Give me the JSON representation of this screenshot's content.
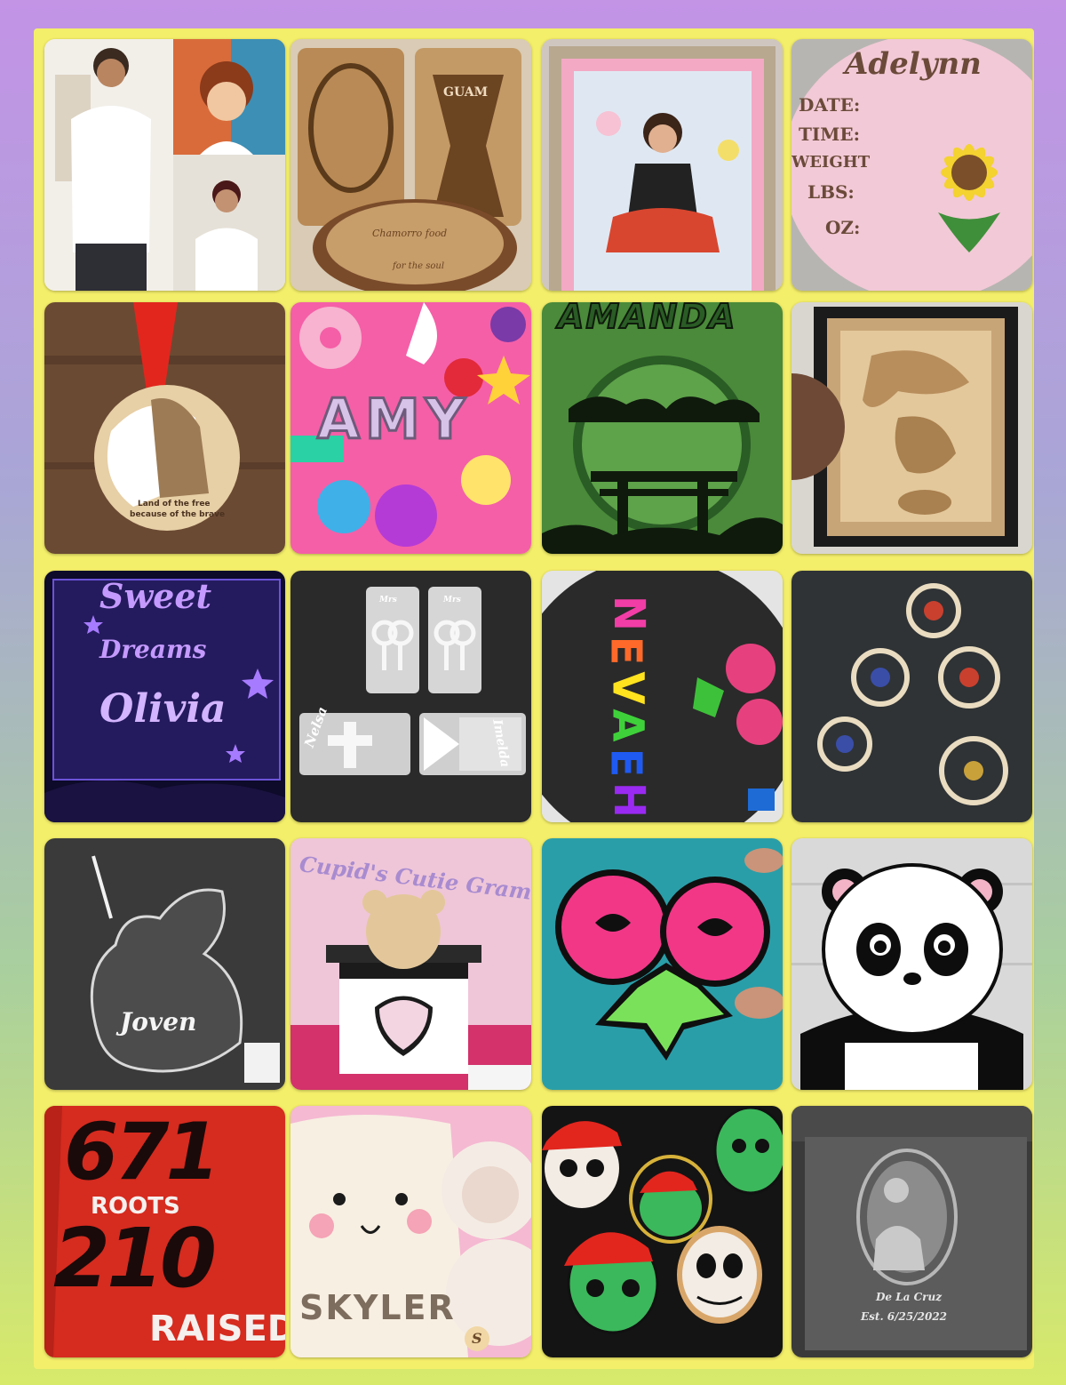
{
  "tiles": {
    "t02": {
      "words": [
        "GUAM",
        "Chamorro food",
        "for the soul"
      ]
    },
    "t04": {
      "name": "Adelynn",
      "fields": [
        "DATE:",
        "TIME:",
        "WEIGHT",
        "LBS:",
        "OZ:"
      ]
    },
    "t05": {
      "line1": "Land of the free",
      "line2": "because of the brave"
    },
    "t06": {
      "name": "AMY"
    },
    "t07": {
      "name": "AMANDA"
    },
    "t09": {
      "line1": "Sweet",
      "line2": "Dreams",
      "line3": "Olivia"
    },
    "t10": {
      "tag": "Mrs",
      "name1": "Nelsa",
      "name2": "Imelda"
    },
    "t11": {
      "letters": [
        "N",
        "E",
        "V",
        "A",
        "E",
        "H"
      ]
    },
    "t13": {
      "name": "Joven"
    },
    "t14": {
      "title": "Cupid's Cutie Gram"
    },
    "t17": {
      "top": "671",
      "mid": "ROOTS",
      "bottom": "210",
      "last": "RAISED"
    },
    "t18": {
      "name": "SKYLER",
      "badge": "S"
    },
    "t20": {
      "name": "De La Cruz",
      "date": "Est. 6/25/2022"
    }
  },
  "colors": {
    "background_top": "#c393e6",
    "background_bottom": "#d8ea6a",
    "board": "#f4ef6a"
  }
}
